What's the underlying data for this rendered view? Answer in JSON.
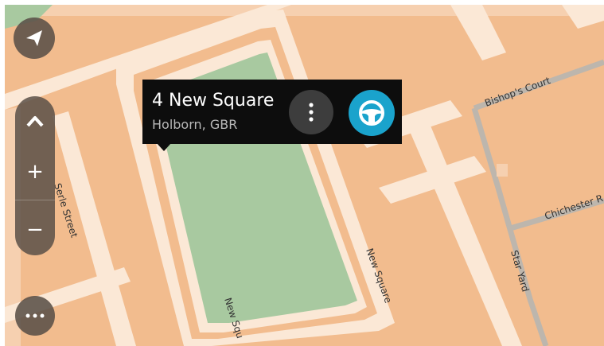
{
  "map": {
    "streets": {
      "serle_street": "Serle Street",
      "new_square_east": "New Square",
      "new_square_south": "New Squ",
      "bishops_court": "Bishop's Court",
      "chichester": "Chichester R",
      "star_yard": "Star Yard"
    },
    "colors": {
      "building": "#f2bc8e",
      "road": "#fbe8d6",
      "green": "#a8c9a0",
      "minor_road": "#bdb6ad"
    }
  },
  "controls": {
    "back_icon": "navigation-arrow-icon",
    "tilt_icon": "chevron-up-icon",
    "zoom_in_label": "+",
    "zoom_out_label": "−",
    "menu_icon": "more-dots-icon"
  },
  "popup": {
    "title": "4 New Square",
    "subtitle": "Holborn, GBR",
    "more_icon": "vertical-dots-icon",
    "drive_icon": "steering-wheel-icon",
    "drive_color": "#1aa3cc"
  }
}
